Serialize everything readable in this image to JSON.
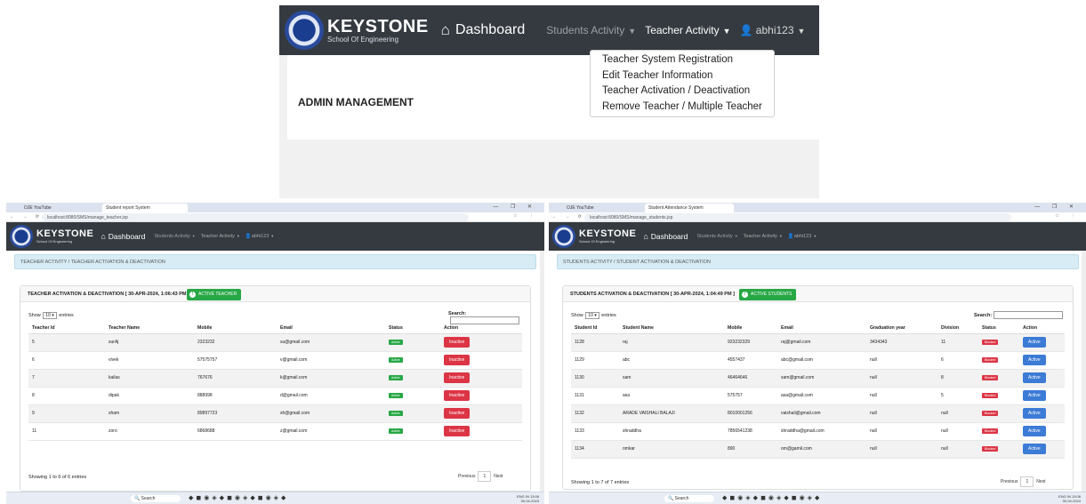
{
  "top": {
    "brand": {
      "name": "KEYSTONE",
      "sub": "School Of Engineering"
    },
    "nav": {
      "dashboard": "Dashboard",
      "students_activity": "Students Activity",
      "teacher_activity": "Teacher Activity",
      "user": "abhi123"
    },
    "admin_title": "ADMIN MANAGEMENT",
    "dropdown": [
      "Teacher System Registration",
      "Edit Teacher Information",
      "Teacher Activation / Deactivation",
      "Remove Teacher / Multiple Teacher"
    ]
  },
  "left": {
    "tabs": [
      "OJE YouTube",
      "Student report System"
    ],
    "url": "localhost:8080/SMS/manage_teacher.jsp",
    "nav": {
      "dashboard": "Dashboard",
      "students_activity": "Students Activity",
      "teacher_activity": "Teacher Activity",
      "user": "abhi123"
    },
    "breadcrumb": "TEACHER ACTIVITY / TEACHER ACTIVATION & DEACTIVATION",
    "card_title": "TEACHER ACTIVATION & DEACTIVATION",
    "timestamp": "[ 30-APR-2024, 1:06:43 PM ]",
    "green_button": "ACTIVE TEACHER",
    "show": "Show",
    "entries_value": "10",
    "entries": "entries",
    "search_label": "Search:",
    "columns": [
      "Teacher Id",
      "Teacher Name",
      "Mobile",
      "Email",
      "Status",
      "Action"
    ],
    "rows": [
      {
        "id": "5",
        "name": "surAj",
        "mobile": "2323232",
        "email": "su@gmail.com",
        "status": "Active",
        "action": "Inactive"
      },
      {
        "id": "6",
        "name": "vivek",
        "mobile": "57575757",
        "email": "v@gmail.com",
        "status": "Active",
        "action": "Inactive"
      },
      {
        "id": "7",
        "name": "kailas",
        "mobile": "767676",
        "email": "k@gmail.com",
        "status": "Active",
        "action": "Inactive"
      },
      {
        "id": "8",
        "name": "dipak",
        "mobile": "888998",
        "email": "d@gmail.com",
        "status": "Active",
        "action": "Inactive"
      },
      {
        "id": "9",
        "name": "sham",
        "mobile": "89897723",
        "email": "sh@gmail.com",
        "status": "Active",
        "action": "Inactive"
      },
      {
        "id": "11",
        "name": "zoro",
        "mobile": "6868688",
        "email": "z@gmail.com",
        "status": "Active",
        "action": "Inactive"
      }
    ],
    "info": "Showing 1 to 6 of 6 entries",
    "pager": {
      "prev": "Previous",
      "page": "1",
      "next": "Next"
    }
  },
  "right": {
    "tabs": [
      "OJE YouTube",
      "Student Attendance System"
    ],
    "url": "localhost:8080/SMS/manage_students.jsp",
    "nav": {
      "dashboard": "Dashboard",
      "students_activity": "Students Activity",
      "teacher_activity": "Teacher Activity",
      "user": "abhi123"
    },
    "breadcrumb": "STUDENTS ACTIVITY / STUDENT ACTIVATION & DEACTIVATION",
    "card_title": "STUDENTS ACTIVATION & DEACTIVATION",
    "timestamp": "[ 30-APR-2024, 1:04:49 PM ]",
    "green_button": "ACTIVE STUDENTS",
    "show": "Show",
    "entries_value": "10",
    "entries": "entries",
    "search_label": "Search:",
    "columns": [
      "Student Id",
      "Student Name",
      "Mobile",
      "Email",
      "Graduation year",
      "Division",
      "Status",
      "Action"
    ],
    "rows": [
      {
        "id": "1128",
        "name": "raj",
        "mobile": "923232329",
        "email": "raj@gmail.com",
        "year": "3434343",
        "div": "11",
        "status": "Blocked",
        "action": "Active"
      },
      {
        "id": "1129",
        "name": "abc",
        "mobile": "4557437",
        "email": "abc@gmail.com",
        "year": "null",
        "div": "6",
        "status": "Blocked",
        "action": "Active"
      },
      {
        "id": "1130",
        "name": "sam",
        "mobile": "46464646",
        "email": "sam@gmail.com",
        "year": "null",
        "div": "8",
        "status": "Blocked",
        "action": "Active"
      },
      {
        "id": "1131",
        "name": "asa",
        "mobile": "575757",
        "email": "asa@gmail.com",
        "year": "null",
        "div": "5",
        "status": "Blocked",
        "action": "Active"
      },
      {
        "id": "1132",
        "name": "ARADE VAISHALI BALAJI",
        "mobile": "8010001256",
        "email": "vaishali@gmail.com",
        "year": "null",
        "div": "null",
        "status": "Blocked",
        "action": "Active"
      },
      {
        "id": "1133",
        "name": "shraddha",
        "mobile": "7856541238",
        "email": "shraddha@gmail.com",
        "year": "null",
        "div": "null",
        "status": "Blocked",
        "action": "Active"
      },
      {
        "id": "1134",
        "name": "omkar",
        "mobile": "890",
        "email": "om@gamil.com",
        "year": "null",
        "div": "null",
        "status": "Blocked",
        "action": "Active"
      }
    ],
    "info": "Showing 1 to 7 of 7 entries",
    "pager": {
      "prev": "Previous",
      "page": "1",
      "next": "Next"
    }
  },
  "taskbar": {
    "search": "Search",
    "lang": "ENG IN",
    "time": "13:06",
    "date": "30-04-2024"
  },
  "colors": {
    "navbar": "#343a40",
    "active_green": "#28a745",
    "inactive_red": "#dc3545",
    "active_blue": "#3c7bd6",
    "breadcrumb_bg": "#d7ecf5"
  }
}
